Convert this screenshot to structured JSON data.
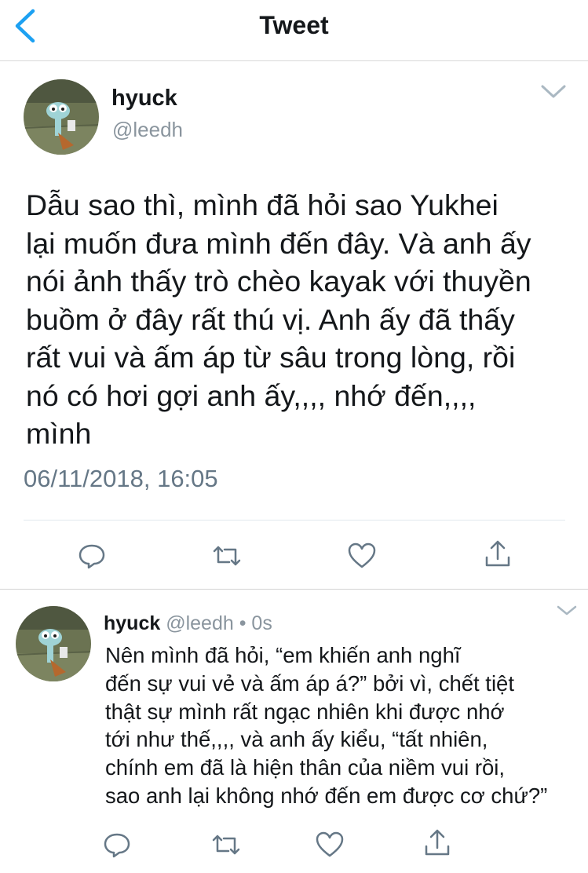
{
  "nav": {
    "title": "Tweet",
    "back_icon": "chevron-left-icon"
  },
  "colors": {
    "accent": "#1da1f2",
    "icon": "#657786",
    "secondary_text": "#8a959e"
  },
  "tweet": {
    "display_name": "hyuck",
    "handle": "@leedh",
    "text": "Dẫu sao thì, mình đã hỏi sao Yukhei\nlại muốn đưa mình đến đây. Và anh ấy\nnói ảnh thấy trò chèo kayak với thuyền\nbuồm ở đây rất thú vị. Anh ấy đã thấy\nrất vui và ấm áp từ sâu trong lòng, rồi\nnó có hơi gợi anh ấy,,,, nhớ đến,,,,\nmình",
    "timestamp": "06/11/2018, 16:05",
    "actions": [
      "reply-icon",
      "retweet-icon",
      "like-icon",
      "share-icon"
    ]
  },
  "reply": {
    "display_name": "hyuck",
    "handle_time": "@leedh • 0s",
    "text": "Nên mình đã hỏi, “em khiến anh nghĩ\nđến sự vui vẻ và ấm áp á?” bởi vì, chết tiệt\nthật sự mình rất ngạc nhiên khi được nhớ\ntới như thế,,,, và anh ấy kiểu, “tất nhiên,\nchính em đã là hiện thân của niềm vui rồi,\nsao anh lại không nhớ đến em được cơ chứ?”",
    "actions": [
      "reply-icon",
      "retweet-icon",
      "like-icon",
      "share-icon"
    ]
  }
}
